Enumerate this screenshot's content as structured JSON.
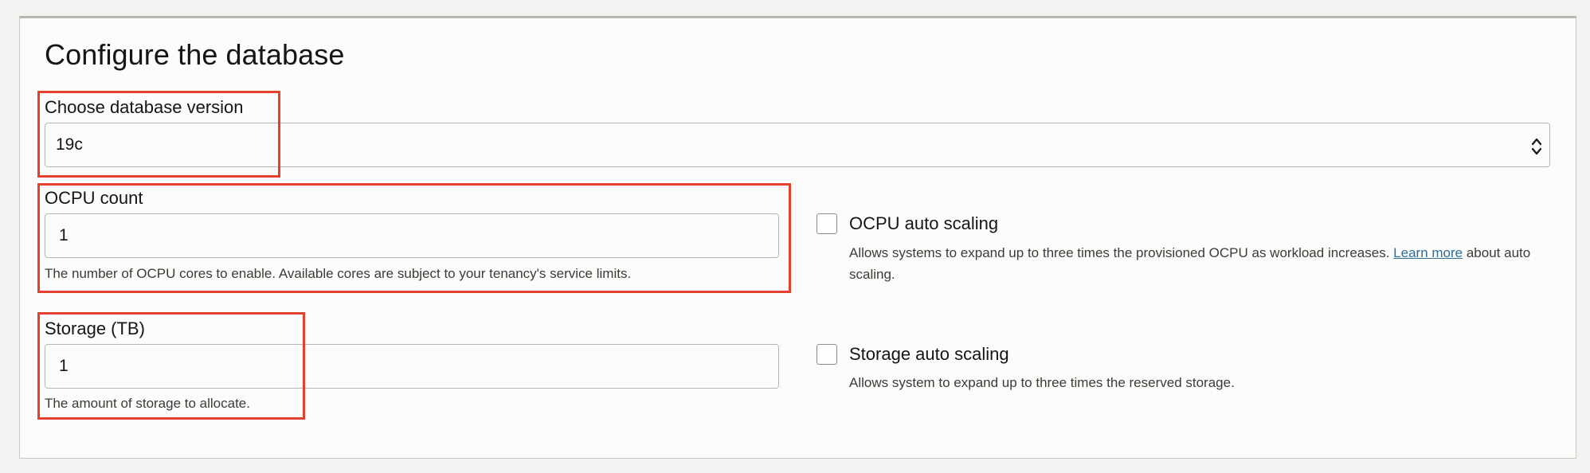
{
  "section": {
    "title": "Configure the database"
  },
  "db_version": {
    "label": "Choose database version",
    "selected": "19c"
  },
  "ocpu": {
    "label": "OCPU count",
    "value": "1",
    "help": "The number of OCPU cores to enable. Available cores are subject to your tenancy's service limits.",
    "auto_scaling": {
      "label": "OCPU auto scaling",
      "checked": false,
      "desc_before": "Allows systems to expand up to three times the provisioned OCPU as workload increases.",
      "link": "Learn more",
      "desc_after": "about auto scaling."
    }
  },
  "storage": {
    "label": "Storage (TB)",
    "value": "1",
    "help": "The amount of storage to allocate.",
    "auto_scaling": {
      "label": "Storage auto scaling",
      "checked": false,
      "desc": "Allows system to expand up to three times the reserved storage."
    }
  },
  "colors": {
    "highlight": "#e2412d",
    "link": "#2d6f9a"
  }
}
